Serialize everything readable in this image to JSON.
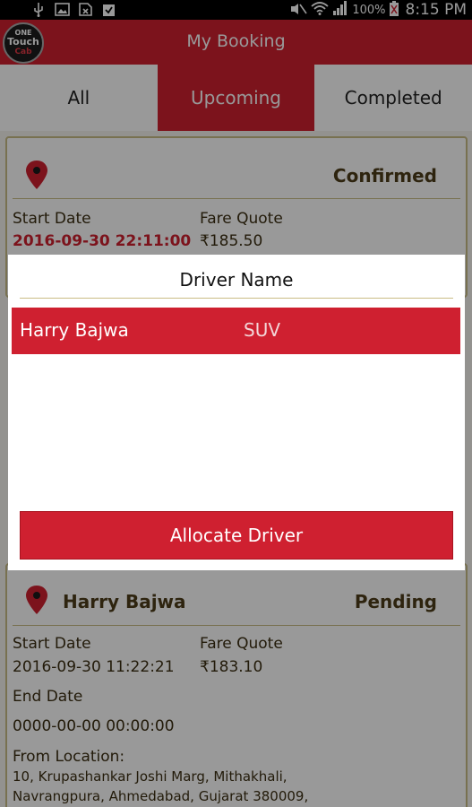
{
  "status_bar": {
    "battery": "100%",
    "time": "8:15 PM"
  },
  "app": {
    "logo_line1": "ONE",
    "logo_line2": "Touch",
    "logo_line3": "Cab",
    "title": "My Booking"
  },
  "tabs": [
    {
      "label": "All",
      "active": false
    },
    {
      "label": "Upcoming",
      "active": true
    },
    {
      "label": "Completed",
      "active": false
    }
  ],
  "bookings": [
    {
      "driver": "",
      "status": "Confirmed",
      "start_label": "Start Date",
      "start_value": "2016-09-30 22:11:00",
      "fare_label": "Fare Quote",
      "fare_value": "₹185.50"
    },
    {
      "driver": "Harry Bajwa",
      "status": "Pending",
      "start_label": "Start Date",
      "start_value": "2016-09-30 11:22:21",
      "fare_label": "Fare Quote",
      "fare_value": "₹183.10",
      "end_label": "End Date",
      "end_value": "0000-00-00 00:00:00",
      "from_label": "From Location:",
      "from_line1": "10, Krupashankar Joshi Marg, Mithakhali,",
      "from_line2": "Navrangpura, Ahmedabad, Gujarat 380009,"
    }
  ],
  "dialog": {
    "title": "Driver Name",
    "drivers": [
      {
        "name": "Harry Bajwa",
        "type": "SUV",
        "selected": true
      }
    ],
    "allocate_label": "Allocate Driver"
  },
  "colors": {
    "primary": "#cf2030",
    "card_border": "#c9bd85",
    "text_brown": "#3b2e12"
  }
}
